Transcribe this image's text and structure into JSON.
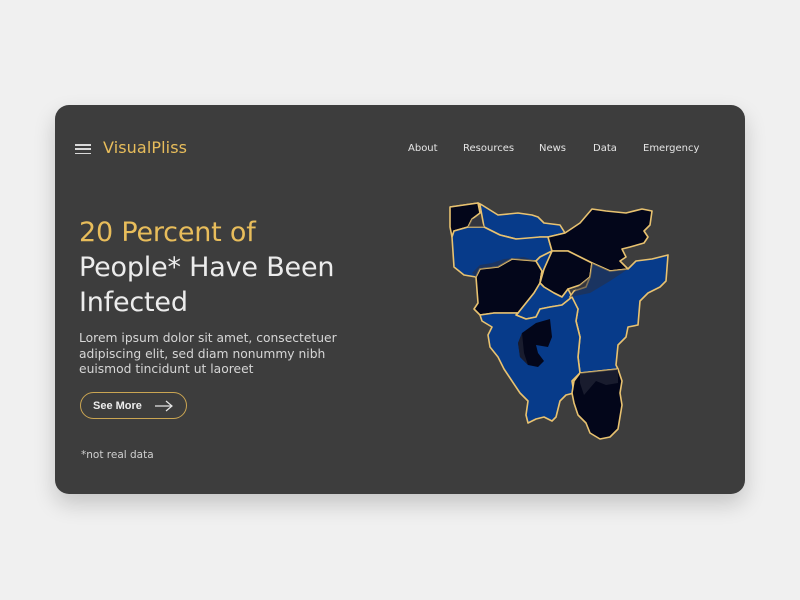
{
  "header": {
    "brand": "VisualPliss",
    "menu_icon": "hamburger-menu-icon",
    "nav": [
      {
        "label": "About"
      },
      {
        "label": "Resources"
      },
      {
        "label": "News"
      },
      {
        "label": "Data"
      },
      {
        "label": "Emergency"
      }
    ]
  },
  "hero": {
    "title_accent": "20 Percent of",
    "title_line2": "People* Have Been",
    "title_line3": "Infected",
    "description_lines": [
      "Lorem ipsum dolor sit amet, consectetuer",
      "adipiscing elit, sed diam nonummy nibh",
      "euismod tincidunt ut laoreet"
    ],
    "cta_label": "See More",
    "cta_icon": "arrow-right-icon",
    "footnote": "*not real data"
  },
  "map": {
    "description": "Choropleth map of regions",
    "legend_colors": {
      "low": "#073b8a",
      "high": "#03061a",
      "shadow": "#262a3a",
      "border": "#e8c270"
    },
    "regions": [
      {
        "name": "north-west-small",
        "level": "high"
      },
      {
        "name": "north-west",
        "level": "low"
      },
      {
        "name": "north-east",
        "level": "high"
      },
      {
        "name": "west",
        "level": "high"
      },
      {
        "name": "central",
        "level": "low"
      },
      {
        "name": "east",
        "level": "low"
      },
      {
        "name": "south",
        "level": "high"
      },
      {
        "name": "south-west",
        "level": "low"
      },
      {
        "name": "south-east",
        "level": "high"
      }
    ]
  },
  "colors": {
    "accent": "#e8bd5b",
    "card_bg": "#3d3d3d",
    "page_bg": "#f0f0f0",
    "text_light": "#ececec"
  }
}
